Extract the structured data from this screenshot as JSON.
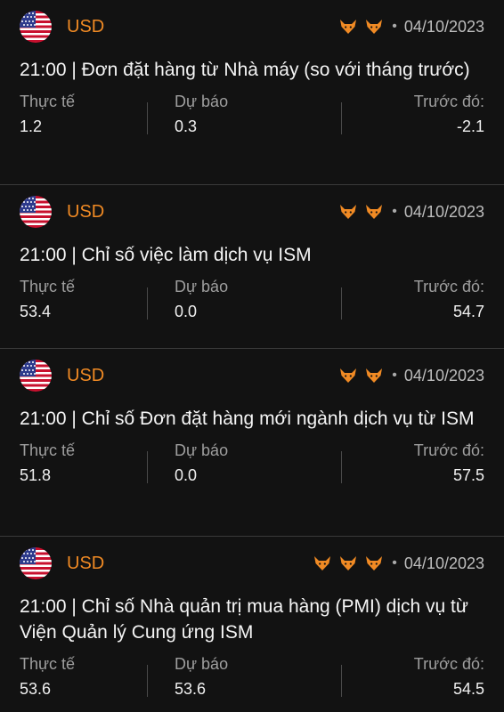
{
  "events": [
    {
      "currency": "USD",
      "importance": 2,
      "date": "04/10/2023",
      "title": "21:00 | Đơn đặt hàng từ Nhà máy (so với tháng trước)",
      "actual_label": "Thực tế",
      "actual": "1.2",
      "forecast_label": "Dự báo",
      "forecast": "0.3",
      "previous_label": "Trước đó:",
      "previous": "-2.1"
    },
    {
      "currency": "USD",
      "importance": 2,
      "date": "04/10/2023",
      "title": "21:00 | Chỉ số việc làm dịch vụ ISM",
      "actual_label": "Thực tế",
      "actual": "53.4",
      "forecast_label": "Dự báo",
      "forecast": "0.0",
      "previous_label": "Trước đó:",
      "previous": "54.7"
    },
    {
      "currency": "USD",
      "importance": 2,
      "date": "04/10/2023",
      "title": "21:00 | Chỉ số Đơn đặt hàng mới ngành dịch vụ từ ISM",
      "actual_label": "Thực tế",
      "actual": "51.8",
      "forecast_label": "Dự báo",
      "forecast": "0.0",
      "previous_label": "Trước đó:",
      "previous": "57.5"
    },
    {
      "currency": "USD",
      "importance": 3,
      "date": "04/10/2023",
      "title": "21:00 | Chỉ số Nhà quản trị mua hàng (PMI) dịch vụ từ Viện Quản lý Cung ứng ISM",
      "actual_label": "Thực tế",
      "actual": "53.6",
      "forecast_label": "Dự báo",
      "forecast": "53.6",
      "previous_label": "Trước đó:",
      "previous": "54.5"
    }
  ],
  "colors": {
    "accent": "#f08a24",
    "background": "#121212",
    "muted": "#9e9e9e"
  },
  "icons": {
    "flag": "us-flag-icon",
    "importance": "bull-icon"
  }
}
